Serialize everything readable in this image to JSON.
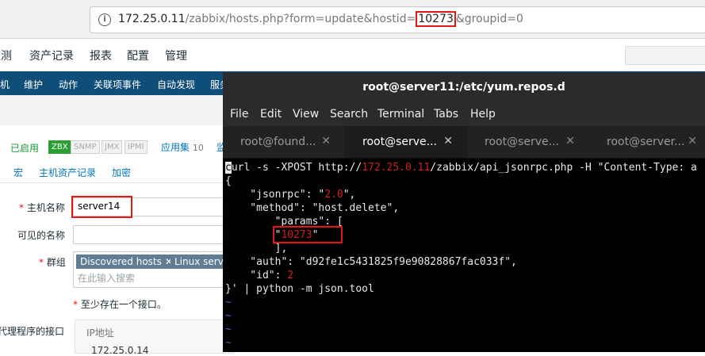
{
  "browser": {
    "url_host": "172.25.0.11",
    "url_path_before": "/zabbix/hosts.php?form=update&hostid=",
    "url_hostid": "10273",
    "url_after": "&groupid=0"
  },
  "topmenu": [
    "监测",
    "资产记录",
    "报表",
    "配置",
    "管理"
  ],
  "submenu": [
    "机",
    "维护",
    "动作",
    "关联项事件",
    "自动发现",
    "服务"
  ],
  "status": {
    "enabled": "已启用",
    "badges": [
      "ZBX",
      "SNMP",
      "JMX",
      "IPMI"
    ],
    "apps_label": "应用集",
    "apps_count": "10",
    "cut_label": "监"
  },
  "form_tabs": [
    "宏",
    "主机资产记录",
    "加密"
  ],
  "form": {
    "hostname_label": "主机名称",
    "hostname_value": "server14",
    "visible_label": "可见的名称",
    "groups_label": "群组",
    "groups": [
      "Discovered hosts",
      "Linux serve"
    ],
    "groups_placeholder": "在此输入搜索",
    "iface_note": "至少存在一个接口。",
    "agent_iface_label": "代理程序的接口",
    "ip_header": "IP地址",
    "ip_value": "172.25.0.14"
  },
  "terminal": {
    "title": "root@server11:/etc/yum.repos.d",
    "menu": [
      "File",
      "Edit",
      "View",
      "Search",
      "Terminal",
      "Tabs",
      "Help"
    ],
    "tabs": [
      "root@found...",
      "root@serve...",
      "root@serve...",
      "root@server..."
    ],
    "active_tab": 1,
    "lines": {
      "l1_a": "url -s -XPOST http://",
      "l1_ip": "172.25.0.11",
      "l1_b": "/zabbix/api_jsonrpc.php -H \"Content-Type: a",
      "l2": "{",
      "l3_a": "    \"jsonrpc\": \"",
      "l3_v": "2.0",
      "l3_b": "\",",
      "l4": "    \"method\": \"host.delete\",",
      "l5": "        \"params\": [",
      "l6_a": "        \"",
      "l6_v": "10273",
      "l6_b": "\"",
      "l7": "        ],",
      "l8": "    \"auth\": \"d92fe1c5431825f9e90828867fac033f\",",
      "l9_a": "    \"id\": ",
      "l9_v": "2",
      "l10": "}' | python -m json.tool",
      "tilde": "~"
    }
  },
  "accent_colors": {
    "highlight_red": "#e01818",
    "zabbix_blue": "#0f4e79",
    "enabled_green": "#2c9e36"
  }
}
